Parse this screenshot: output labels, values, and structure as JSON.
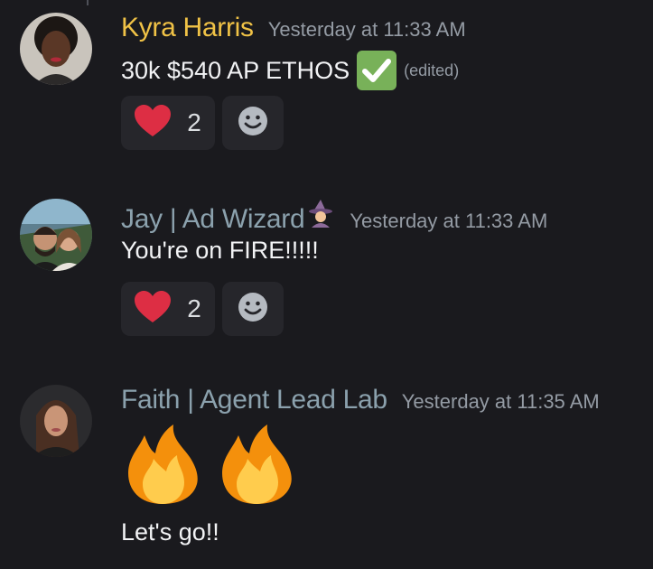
{
  "messages": [
    {
      "author": "Kyra Harris",
      "author_color": "#f0c246",
      "timestamp": "Yesterday at 11:33 AM",
      "text": "30k $540 AP ETHOS",
      "emoji": "white-check-mark",
      "edited": "(edited)",
      "reactions": [
        {
          "emoji": "red-heart",
          "count": "2"
        },
        {
          "emoji": "add-reaction-smiley"
        }
      ]
    },
    {
      "author": "Jay | Ad Wizard",
      "author_suffix_emoji": "woman-mage",
      "author_color": "#8ba1ad",
      "timestamp": "Yesterday at 11:33 AM",
      "text": "You're on FIRE!!!!!",
      "reactions": [
        {
          "emoji": "red-heart",
          "count": "2"
        },
        {
          "emoji": "add-reaction-smiley"
        }
      ]
    },
    {
      "author": "Faith | Agent Lead Lab",
      "author_color": "#8ba1ad",
      "timestamp": "Yesterday at 11:35 AM",
      "big_emojis": [
        "fire",
        "fire"
      ],
      "text": "Let's go!!"
    }
  ],
  "colors": {
    "background": "#1a1a1e",
    "reaction_bg": "#26262b",
    "timestamp": "#949ba4"
  }
}
